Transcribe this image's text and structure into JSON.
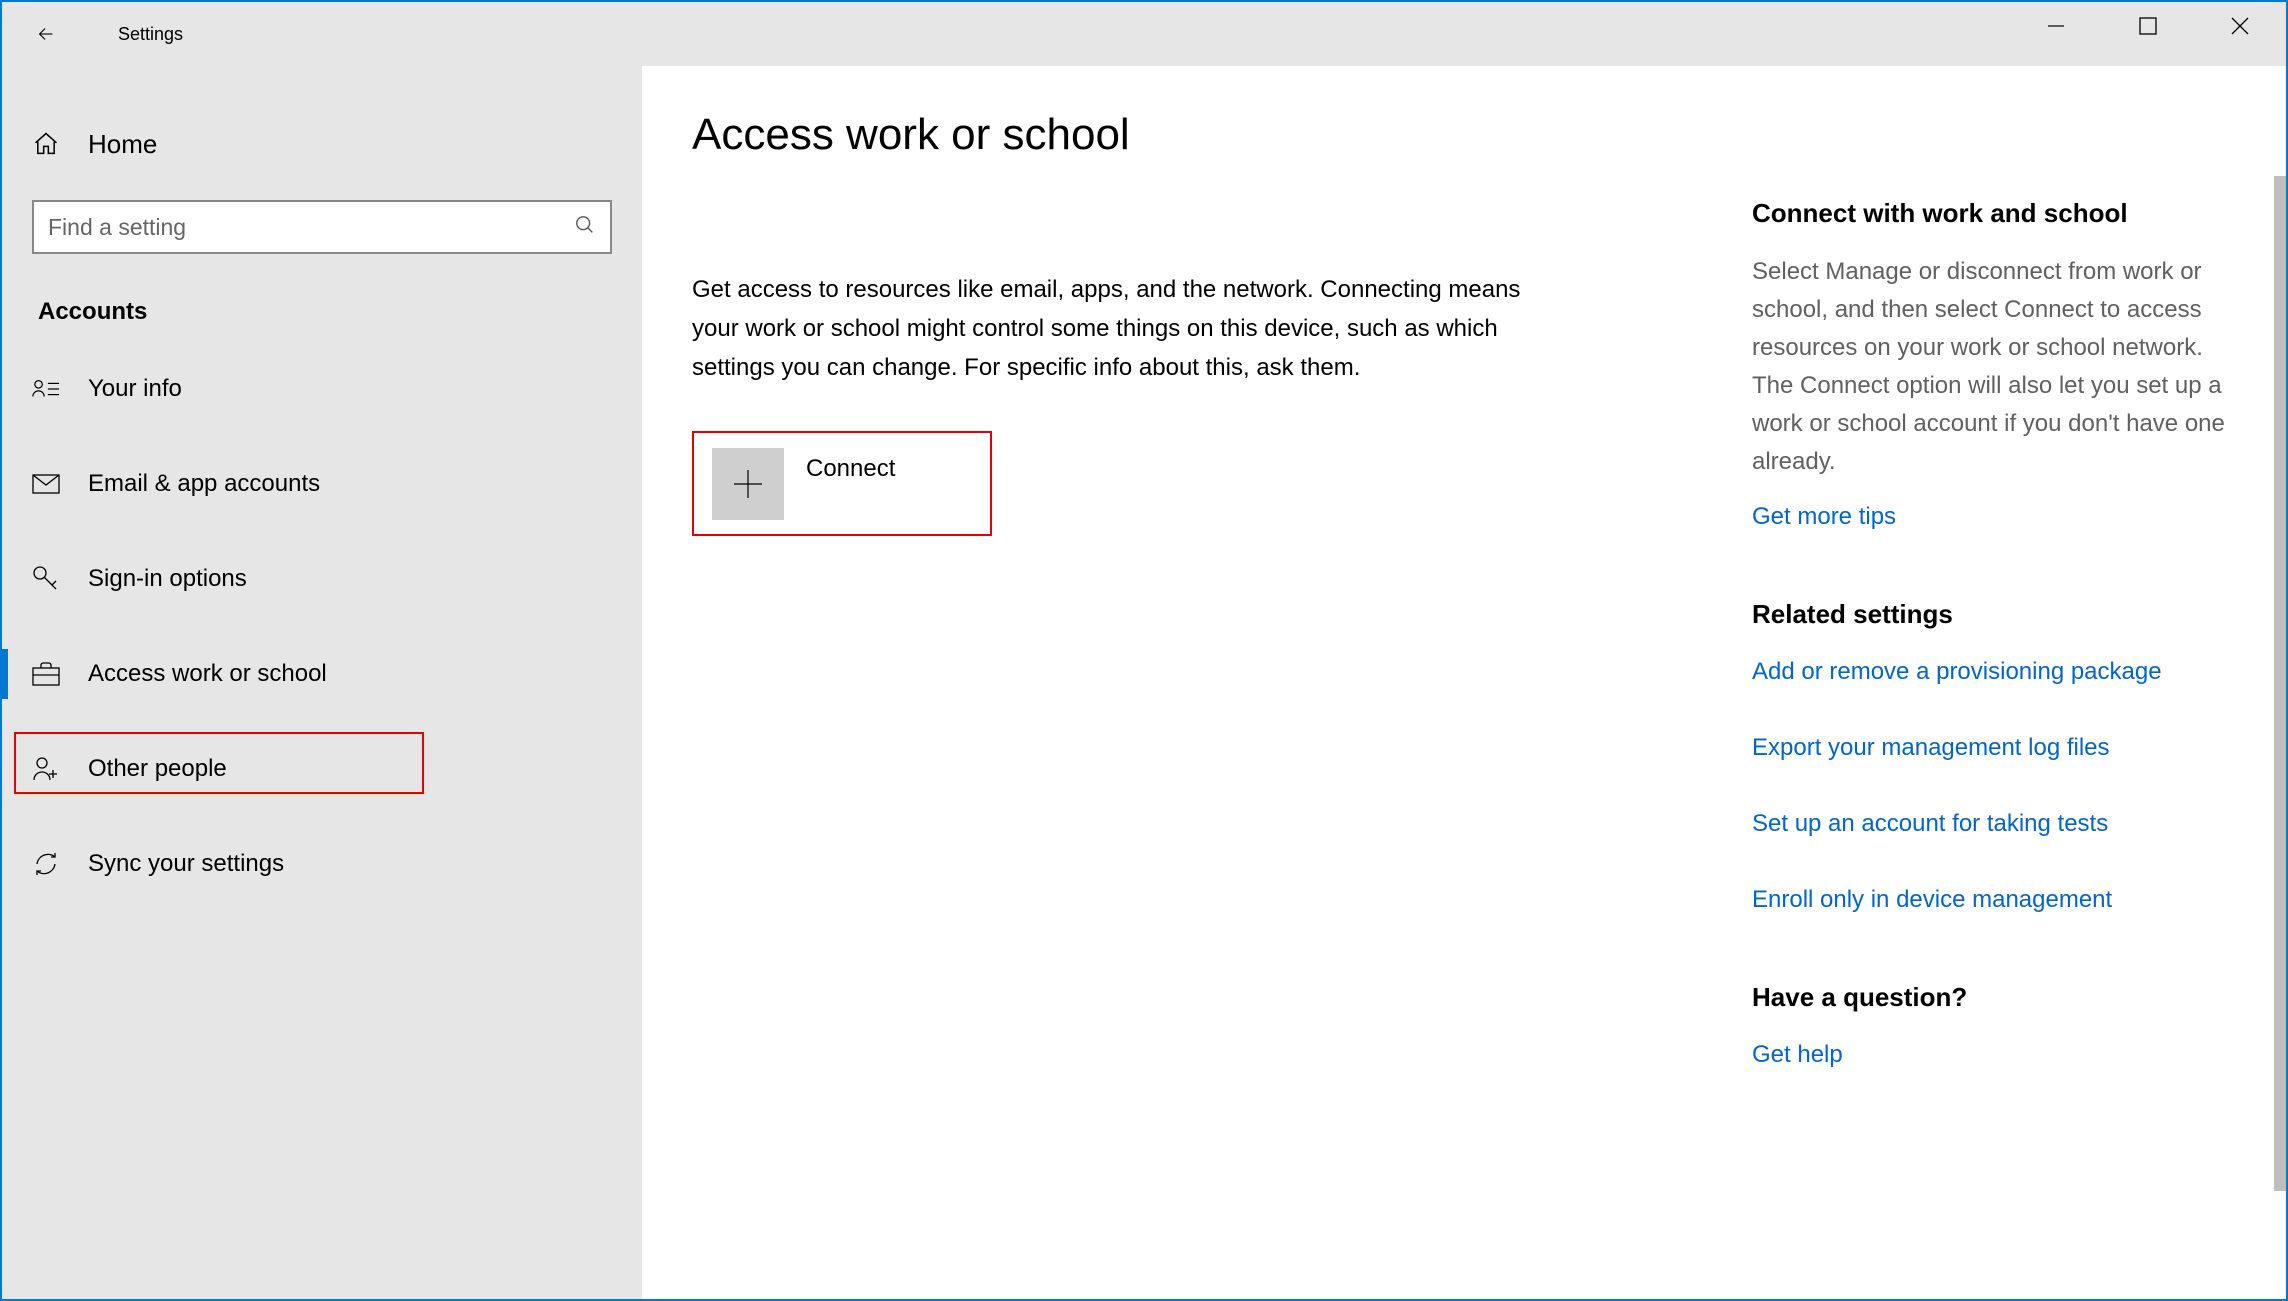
{
  "titlebar": {
    "title": "Settings"
  },
  "sidebar": {
    "home_label": "Home",
    "search_placeholder": "Find a setting",
    "section": "Accounts",
    "items": [
      {
        "label": "Your info"
      },
      {
        "label": "Email & app accounts"
      },
      {
        "label": "Sign-in options"
      },
      {
        "label": "Access work or school"
      },
      {
        "label": "Other people"
      },
      {
        "label": "Sync your settings"
      }
    ]
  },
  "main": {
    "heading": "Access work or school",
    "description": "Get access to resources like email, apps, and the network. Connecting means your work or school might control some things on this device, such as which settings you can change. For specific info about this, ask them.",
    "connect_label": "Connect"
  },
  "right": {
    "connect_heading": "Connect with work and school",
    "connect_text": "Select Manage or disconnect from work or school, and then select Connect to access resources on your work or school network. The Connect option will also let you set up a work or school account if you don't have one already.",
    "more_tips": "Get more tips",
    "related_heading": "Related settings",
    "related_links": [
      "Add or remove a provisioning package",
      "Export your management log files",
      "Set up an account for taking tests",
      "Enroll only in device management"
    ],
    "question_heading": "Have a question?",
    "get_help": "Get help"
  }
}
